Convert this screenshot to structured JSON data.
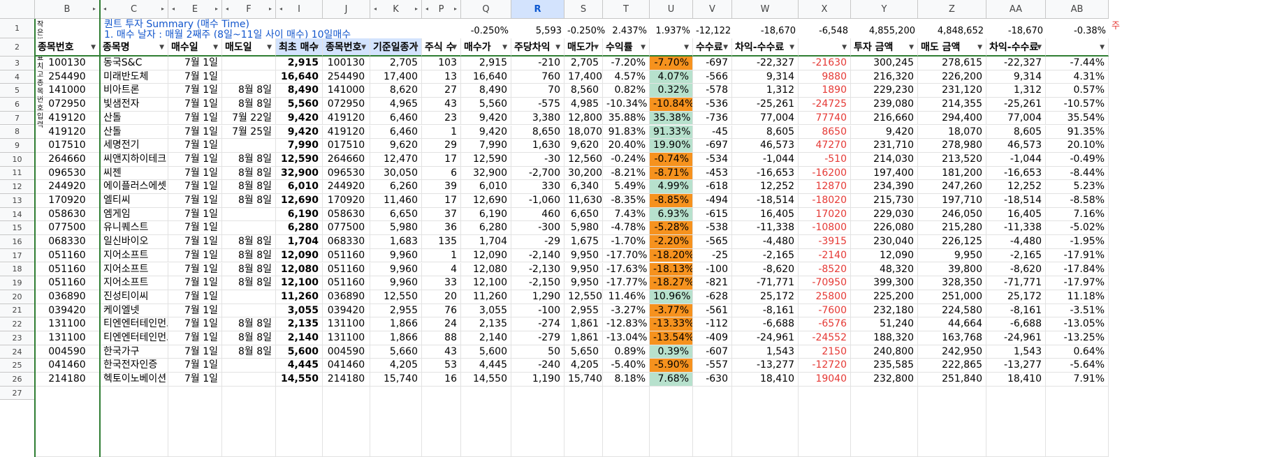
{
  "columns": [
    {
      "letter": "B",
      "w": 93
    },
    {
      "letter": "C",
      "w": 98
    },
    {
      "letter": "E",
      "w": 77
    },
    {
      "letter": "F",
      "w": 77
    },
    {
      "letter": "I",
      "w": 67
    },
    {
      "letter": "J",
      "w": 68
    },
    {
      "letter": "K",
      "w": 74
    },
    {
      "letter": "P",
      "w": 56
    },
    {
      "letter": "Q",
      "w": 72
    },
    {
      "letter": "R",
      "w": 76
    },
    {
      "letter": "S",
      "w": 55
    },
    {
      "letter": "T",
      "w": 67
    },
    {
      "letter": "U",
      "w": 62
    },
    {
      "letter": "V",
      "w": 56
    },
    {
      "letter": "W",
      "w": 95
    },
    {
      "letter": "X",
      "w": 75
    },
    {
      "letter": "Y",
      "w": 96
    },
    {
      "letter": "Z",
      "w": 98
    },
    {
      "letter": "AA",
      "w": 85
    },
    {
      "letter": "AB",
      "w": 90
    }
  ],
  "selected_column": "R",
  "row1": {
    "note_line1": "작은따옴표 치고",
    "note_line2": "종목번호 입력",
    "title_line1": "퀀트 투자 Summary (매수 Time)",
    "title_line2": "1. 매수 날자 : 매월 2째주 (8일~11일 사이 매수) 10일매수",
    "Q": "-0.250%",
    "R": "5,593",
    "S": "-0.250%",
    "T": "2.437%",
    "U": "1.937%",
    "V": "-12,122",
    "W": "-18,670",
    "X": "-6,548",
    "Y": "4,855,200",
    "Z": "4,848,652",
    "AA": "-18,670",
    "AB": "-0.38%",
    "overflow_char": "주"
  },
  "headers": [
    "종목번호",
    "종목명",
    "매수일",
    "매도일",
    "최초 매수",
    "종목번호",
    "기준일종가",
    "주식 수",
    "매수가",
    "주당차익",
    "매도가",
    "수익률",
    "",
    "수수료",
    "차익-수수료",
    "",
    "투자 금액",
    "매도 금액",
    "차익-수수료",
    ""
  ],
  "rows": [
    [
      "100130",
      "동국S&C",
      "7월 1일",
      "",
      "2,915",
      "100130",
      "2,705",
      "103",
      "2,915",
      "-210",
      "2,705",
      "-7.20%",
      "-7.70%",
      "-697",
      "-22,327",
      "-21630",
      "300,245",
      "278,615",
      "-22,327",
      "-7.44%"
    ],
    [
      "254490",
      "미래반도체",
      "7월 1일",
      "",
      "16,640",
      "254490",
      "17,400",
      "13",
      "16,640",
      "760",
      "17,400",
      "4.57%",
      "4.07%",
      "-566",
      "9,314",
      "9880",
      "216,320",
      "226,200",
      "9,314",
      "4.31%"
    ],
    [
      "141000",
      "비아트론",
      "7월 1일",
      "8월 8일",
      "8,490",
      "141000",
      "8,620",
      "27",
      "8,490",
      "70",
      "8,560",
      "0.82%",
      "0.32%",
      "-578",
      "1,312",
      "1890",
      "229,230",
      "231,120",
      "1,312",
      "0.57%"
    ],
    [
      "072950",
      "빛샘전자",
      "7월 1일",
      "8월 8일",
      "5,560",
      "072950",
      "4,965",
      "43",
      "5,560",
      "-575",
      "4,985",
      "-10.34%",
      "-10.84%",
      "-536",
      "-25,261",
      "-24725",
      "239,080",
      "214,355",
      "-25,261",
      "-10.57%"
    ],
    [
      "419120",
      "산돌",
      "7월 1일",
      "7월 22일",
      "9,420",
      "419120",
      "6,460",
      "23",
      "9,420",
      "3,380",
      "12,800",
      "35.88%",
      "35.38%",
      "-736",
      "77,004",
      "77740",
      "216,660",
      "294,400",
      "77,004",
      "35.54%"
    ],
    [
      "419120",
      "산돌",
      "7월 1일",
      "7월 25일",
      "9,420",
      "419120",
      "6,460",
      "1",
      "9,420",
      "8,650",
      "18,070",
      "91.83%",
      "91.33%",
      "-45",
      "8,605",
      "8650",
      "9,420",
      "18,070",
      "8,605",
      "91.35%"
    ],
    [
      "017510",
      "세명전기",
      "7월 1일",
      "",
      "7,990",
      "017510",
      "9,620",
      "29",
      "7,990",
      "1,630",
      "9,620",
      "20.40%",
      "19.90%",
      "-697",
      "46,573",
      "47270",
      "231,710",
      "278,980",
      "46,573",
      "20.10%"
    ],
    [
      "264660",
      "씨앤지하이테크",
      "7월 1일",
      "8월 8일",
      "12,590",
      "264660",
      "12,470",
      "17",
      "12,590",
      "-30",
      "12,560",
      "-0.24%",
      "-0.74%",
      "-534",
      "-1,044",
      "-510",
      "214,030",
      "213,520",
      "-1,044",
      "-0.49%"
    ],
    [
      "096530",
      "씨젠",
      "7월 1일",
      "8월 8일",
      "32,900",
      "096530",
      "30,050",
      "6",
      "32,900",
      "-2,700",
      "30,200",
      "-8.21%",
      "-8.71%",
      "-453",
      "-16,653",
      "-16200",
      "197,400",
      "181,200",
      "-16,653",
      "-8.44%"
    ],
    [
      "244920",
      "에이플러스에셋",
      "7월 1일",
      "8월 8일",
      "6,010",
      "244920",
      "6,260",
      "39",
      "6,010",
      "330",
      "6,340",
      "5.49%",
      "4.99%",
      "-618",
      "12,252",
      "12870",
      "234,390",
      "247,260",
      "12,252",
      "5.23%"
    ],
    [
      "170920",
      "엘티씨",
      "7월 1일",
      "8월 8일",
      "12,690",
      "170920",
      "11,460",
      "17",
      "12,690",
      "-1,060",
      "11,630",
      "-8.35%",
      "-8.85%",
      "-494",
      "-18,514",
      "-18020",
      "215,730",
      "197,710",
      "-18,514",
      "-8.58%"
    ],
    [
      "058630",
      "엠게임",
      "7월 1일",
      "",
      "6,190",
      "058630",
      "6,650",
      "37",
      "6,190",
      "460",
      "6,650",
      "7.43%",
      "6.93%",
      "-615",
      "16,405",
      "17020",
      "229,030",
      "246,050",
      "16,405",
      "7.16%"
    ],
    [
      "077500",
      "유니퀘스트",
      "7월 1일",
      "",
      "6,280",
      "077500",
      "5,980",
      "36",
      "6,280",
      "-300",
      "5,980",
      "-4.78%",
      "-5.28%",
      "-538",
      "-11,338",
      "-10800",
      "226,080",
      "215,280",
      "-11,338",
      "-5.02%"
    ],
    [
      "068330",
      "일신바이오",
      "7월 1일",
      "8월 8일",
      "1,704",
      "068330",
      "1,683",
      "135",
      "1,704",
      "-29",
      "1,675",
      "-1.70%",
      "-2.20%",
      "-565",
      "-4,480",
      "-3915",
      "230,040",
      "226,125",
      "-4,480",
      "-1.95%"
    ],
    [
      "051160",
      "지어소프트",
      "7월 1일",
      "8월 8일",
      "12,090",
      "051160",
      "9,960",
      "1",
      "12,090",
      "-2,140",
      "9,950",
      "-17.70%",
      "-18.20%",
      "-25",
      "-2,165",
      "-2140",
      "12,090",
      "9,950",
      "-2,165",
      "-17.91%"
    ],
    [
      "051160",
      "지어소프트",
      "7월 1일",
      "8월 8일",
      "12,080",
      "051160",
      "9,960",
      "4",
      "12,080",
      "-2,130",
      "9,950",
      "-17.63%",
      "-18.13%",
      "-100",
      "-8,620",
      "-8520",
      "48,320",
      "39,800",
      "-8,620",
      "-17.84%"
    ],
    [
      "051160",
      "지어소프트",
      "7월 1일",
      "8월 8일",
      "12,100",
      "051160",
      "9,960",
      "33",
      "12,100",
      "-2,150",
      "9,950",
      "-17.77%",
      "-18.27%",
      "-821",
      "-71,771",
      "-70950",
      "399,300",
      "328,350",
      "-71,771",
      "-17.97%"
    ],
    [
      "036890",
      "진성티이씨",
      "7월 1일",
      "",
      "11,260",
      "036890",
      "12,550",
      "20",
      "11,260",
      "1,290",
      "12,550",
      "11.46%",
      "10.96%",
      "-628",
      "25,172",
      "25800",
      "225,200",
      "251,000",
      "25,172",
      "11.18%"
    ],
    [
      "039420",
      "케이엘넷",
      "7월 1일",
      "",
      "3,055",
      "039420",
      "2,955",
      "76",
      "3,055",
      "-100",
      "2,955",
      "-3.27%",
      "-3.77%",
      "-561",
      "-8,161",
      "-7600",
      "232,180",
      "224,580",
      "-8,161",
      "-3.51%"
    ],
    [
      "131100",
      "티엔엔터테인먼트",
      "7월 1일",
      "8월 8일",
      "2,135",
      "131100",
      "1,866",
      "24",
      "2,135",
      "-274",
      "1,861",
      "-12.83%",
      "-13.33%",
      "-112",
      "-6,688",
      "-6576",
      "51,240",
      "44,664",
      "-6,688",
      "-13.05%"
    ],
    [
      "131100",
      "티엔엔터테인먼트",
      "7월 1일",
      "8월 8일",
      "2,140",
      "131100",
      "1,866",
      "88",
      "2,140",
      "-279",
      "1,861",
      "-13.04%",
      "-13.54%",
      "-409",
      "-24,961",
      "-24552",
      "188,320",
      "163,768",
      "-24,961",
      "-13.25%"
    ],
    [
      "004590",
      "한국가구",
      "7월 1일",
      "8월 8일",
      "5,600",
      "004590",
      "5,660",
      "43",
      "5,600",
      "50",
      "5,650",
      "0.89%",
      "0.39%",
      "-607",
      "1,543",
      "2150",
      "240,800",
      "242,950",
      "1,543",
      "0.64%"
    ],
    [
      "041460",
      "한국전자인증",
      "7월 1일",
      "",
      "4,445",
      "041460",
      "4,205",
      "53",
      "4,445",
      "-240",
      "4,205",
      "-5.40%",
      "-5.90%",
      "-557",
      "-13,277",
      "-12720",
      "235,585",
      "222,865",
      "-13,277",
      "-5.64%"
    ],
    [
      "214180",
      "헥토이노베이션",
      "7월 1일",
      "",
      "14,550",
      "214180",
      "15,740",
      "16",
      "14,550",
      "1,190",
      "15,740",
      "8.18%",
      "7.68%",
      "-630",
      "18,410",
      "19040",
      "232,800",
      "251,840",
      "18,410",
      "7.91%"
    ]
  ],
  "row_numbers": [
    "1",
    "2",
    "3",
    "4",
    "5",
    "6",
    "7",
    "8",
    "9",
    "10",
    "11",
    "12",
    "13",
    "14",
    "15",
    "16",
    "17",
    "18",
    "19",
    "20",
    "21",
    "22",
    "23",
    "24",
    "25",
    "26",
    "27"
  ],
  "colors": {
    "gain_fill": "#b7e1cd",
    "loss_fill": "#f6921e",
    "negative_text": "#e53935",
    "title_text": "#1155cc",
    "frozen_border": "#2e7d32",
    "selected_header": "#d3e3fd"
  },
  "icons": {
    "filter": "filter-icon",
    "expand": "expand-column-icon"
  }
}
